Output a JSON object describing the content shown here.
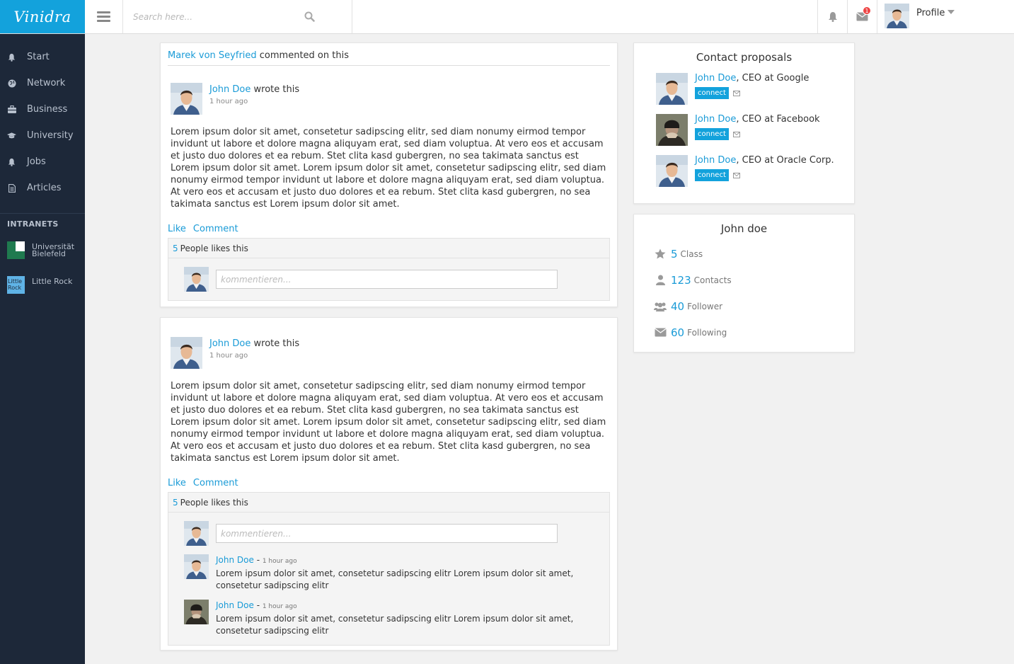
{
  "app": {
    "brand": "Vinidra",
    "accent": "#13a2dc",
    "sidebar_bg": "#1d2839"
  },
  "search": {
    "placeholder": "Search here..."
  },
  "header": {
    "notification_count": "1",
    "profile_label": "Profile"
  },
  "sidebar": {
    "items": [
      {
        "label": "Start",
        "icon": "bell-icon"
      },
      {
        "label": "Network",
        "icon": "globe-icon"
      },
      {
        "label": "Business",
        "icon": "briefcase-icon"
      },
      {
        "label": "University",
        "icon": "graduation-cap-icon"
      },
      {
        "label": "Jobs",
        "icon": "bell-icon"
      },
      {
        "label": "Articles",
        "icon": "document-icon"
      }
    ],
    "intranets_title": "INTRANETS",
    "intranets": [
      {
        "label_line1": "Universität",
        "label_line2": "Bielefeld"
      },
      {
        "label": "Little Rock",
        "logo_text_1": "Little",
        "logo_text_2": "Rock"
      }
    ]
  },
  "posts": [
    {
      "activity_user": "Marek von Seyfried",
      "activity_text": " commented on this",
      "author": "John Doe",
      "author_suffix": " wrote this",
      "time": "1 hour ago",
      "body": "Lorem ipsum dolor sit amet, consetetur sadipscing elitr, sed diam nonumy eirmod tempor invidunt ut labore et dolore magna aliquyam erat, sed diam voluptua. At vero eos et accusam et justo duo dolores et ea rebum. Stet clita kasd gubergren, no sea takimata sanctus est Lorem ipsum dolor sit amet. Lorem ipsum dolor sit amet, consetetur sadipscing elitr, sed diam nonumy eirmod tempor invidunt ut labore et dolore magna aliquyam erat, sed diam voluptua. At vero eos et accusam et justo duo dolores et ea rebum. Stet clita kasd gubergren, no sea takimata sanctus est Lorem ipsum dolor sit amet.",
      "like_label": "Like",
      "comment_label": "Comment",
      "likes_count": "5",
      "likes_text": "People likes this",
      "comment_placeholder": "kommentieren..."
    },
    {
      "author": "John Doe",
      "author_suffix": " wrote this",
      "time": "1 hour ago",
      "body": "Lorem ipsum dolor sit amet, consetetur sadipscing elitr, sed diam nonumy eirmod tempor invidunt ut labore et dolore magna aliquyam erat, sed diam voluptua. At vero eos et accusam et justo duo dolores et ea rebum. Stet clita kasd gubergren, no sea takimata sanctus est Lorem ipsum dolor sit amet. Lorem ipsum dolor sit amet, consetetur sadipscing elitr, sed diam nonumy eirmod tempor invidunt ut labore et dolore magna aliquyam erat, sed diam voluptua. At vero eos et accusam et justo duo dolores et ea rebum. Stet clita kasd gubergren, no sea takimata sanctus est Lorem ipsum dolor sit amet.",
      "like_label": "Like",
      "comment_label": "Comment",
      "likes_count": "5",
      "likes_text": "People likes this",
      "comment_placeholder": "kommentieren...",
      "comments": [
        {
          "author": "John Doe",
          "time": "1 hour ago",
          "text": "Lorem ipsum dolor sit amet, consetetur sadipscing elitr Lorem ipsum dolor sit amet, consetetur sadipscing elitr"
        },
        {
          "author": "John Doe",
          "time": "1 hour ago",
          "text": "Lorem ipsum dolor sit amet, consetetur sadipscing elitr Lorem ipsum dolor sit amet, consetetur sadipscing elitr"
        }
      ]
    }
  ],
  "contact_proposals": {
    "title": "Contact proposals",
    "connect_label": "connect",
    "items": [
      {
        "name": "John Doe",
        "role": ", CEO at Google"
      },
      {
        "name": "John Doe",
        "role": ", CEO at Facebook"
      },
      {
        "name": "John Doe",
        "role": ", CEO at Oracle Corp."
      }
    ]
  },
  "profile_box": {
    "title": "John doe",
    "stats": [
      {
        "value": "5",
        "label": "Class",
        "icon": "star-icon"
      },
      {
        "value": "123",
        "label": "Contacts",
        "icon": "user-icon"
      },
      {
        "value": "40",
        "label": "Follower",
        "icon": "users-icon"
      },
      {
        "value": "60",
        "label": "Following",
        "icon": "envelope-icon"
      }
    ]
  }
}
